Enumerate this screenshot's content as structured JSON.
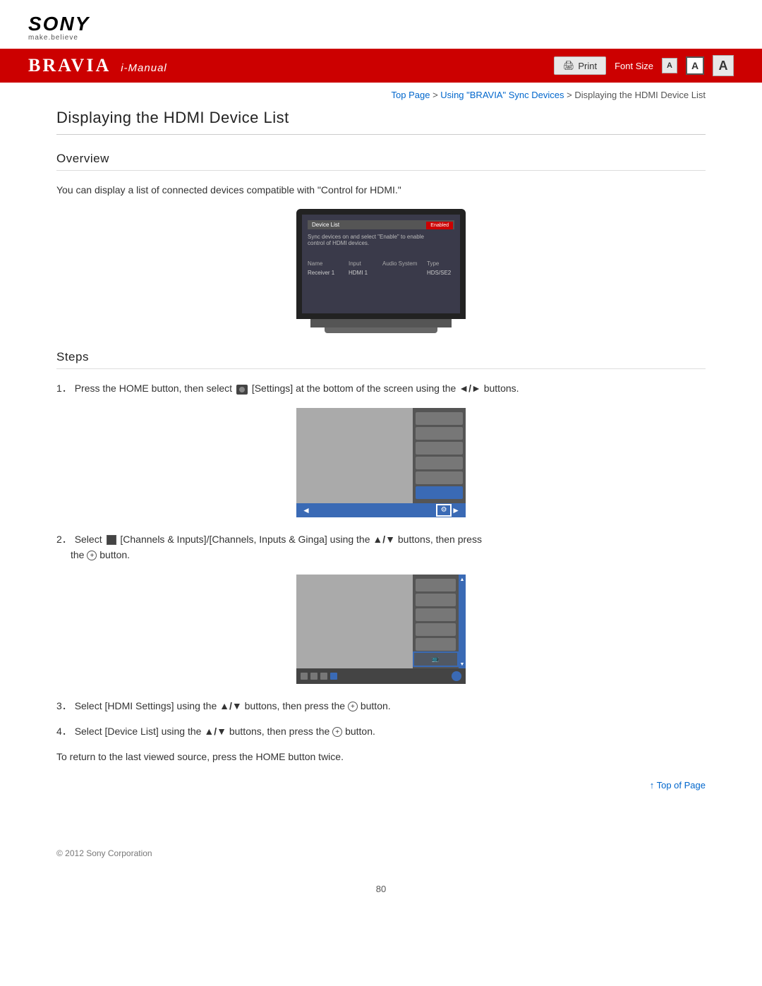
{
  "header": {
    "sony_text": "SONY",
    "sony_tagline": "make.believe",
    "bravia_title": "BRAVIA",
    "bravia_subtitle": "i-Manual",
    "print_label": "Print",
    "font_size_label": "Font Size",
    "font_small": "A",
    "font_medium": "A",
    "font_large": "A"
  },
  "breadcrumb": {
    "top_page": "Top Page",
    "separator1": " > ",
    "sync_devices": "Using \"BRAVIA\" Sync Devices",
    "separator2": " > ",
    "current": "Displaying the HDMI Device List"
  },
  "page": {
    "title": "Displaying the HDMI Device List",
    "overview_heading": "Overview",
    "overview_text": "You can display a list of connected devices compatible with \"Control for HDMI.\"",
    "steps_heading": "Steps",
    "step1": "Press the HOME button, then select",
    "step1_icon": "[Settings]",
    "step1_text": "at the bottom of the screen using the",
    "step1_arrows": "◄/►",
    "step1_end": "buttons.",
    "step2_pre": "Select",
    "step2_icon": "[Channels & Inputs]/[Channels, Inputs & Ginga] using the",
    "step2_arrows": "▲/▼",
    "step2_text": "buttons, then press",
    "step2_btn": "the",
    "step2_circle": "⊕",
    "step2_end": "button.",
    "step3": "Select [HDMI Settings] using the",
    "step3_arrows": "▲/▼",
    "step3_text": "buttons, then press the",
    "step3_circle": "⊕",
    "step3_end": "button.",
    "step4": "Select [Device List] using the",
    "step4_arrows": "▲/▼",
    "step4_text": "buttons, then press the",
    "step4_circle": "⊕",
    "step4_end": "button.",
    "return_note": "To return to the last viewed source, press the HOME button twice.",
    "top_of_page": "↑ Top of Page",
    "copyright": "© 2012 Sony Corporation",
    "page_number": "80"
  }
}
